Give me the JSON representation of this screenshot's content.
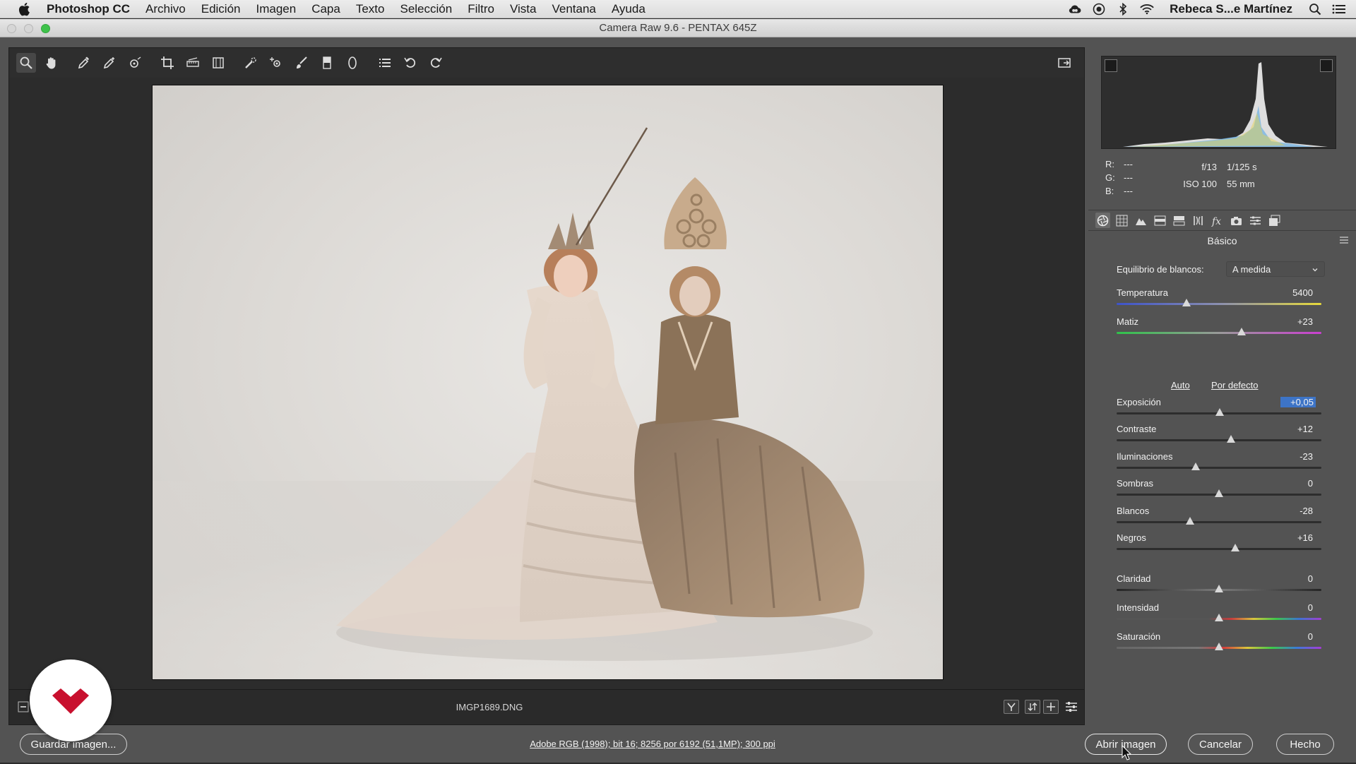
{
  "menubar": {
    "app_name": "Photoshop CC",
    "items": [
      "Archivo",
      "Edición",
      "Imagen",
      "Capa",
      "Texto",
      "Selección",
      "Filtro",
      "Vista",
      "Ventana",
      "Ayuda"
    ],
    "user": "Rebeca S...e Martínez"
  },
  "window": {
    "title": "Camera Raw 9.6 -  PENTAX 645Z"
  },
  "image": {
    "filename": "IMGP1689.DNG"
  },
  "readout": {
    "r_label": "R:",
    "g_label": "G:",
    "b_label": "B:",
    "r": "---",
    "g": "---",
    "b": "---"
  },
  "exif": {
    "aperture": "f/13",
    "shutter": "1/125 s",
    "iso": "ISO 100",
    "focal": "55 mm"
  },
  "panel": {
    "section_title": "Básico",
    "white_balance_label": "Equilibrio de blancos:",
    "white_balance_value": "A medida",
    "auto_link": "Auto",
    "default_link": "Por defecto",
    "sliders": {
      "temperature": {
        "label": "Temperatura",
        "value": "5400",
        "level": 0.34
      },
      "tint": {
        "label": "Matiz",
        "value": "+23",
        "level": 0.61
      },
      "exposure": {
        "label": "Exposición",
        "value": "+0,05",
        "level": 0.505
      },
      "contrast": {
        "label": "Contraste",
        "value": "+12",
        "level": 0.56
      },
      "highlights": {
        "label": "Iluminaciones",
        "value": "-23",
        "level": 0.385
      },
      "shadows": {
        "label": "Sombras",
        "value": "0",
        "level": 0.5
      },
      "whites": {
        "label": "Blancos",
        "value": "-28",
        "level": 0.36
      },
      "blacks": {
        "label": "Negros",
        "value": "+16",
        "level": 0.58
      },
      "clarity": {
        "label": "Claridad",
        "value": "0",
        "level": 0.5
      },
      "vibrance": {
        "label": "Intensidad",
        "value": "0",
        "level": 0.5
      },
      "saturation": {
        "label": "Saturación",
        "value": "0",
        "level": 0.5
      }
    }
  },
  "bottombar": {
    "save_label": "Guardar imagen...",
    "workflow": "Adobe RGB (1998); bit 16; 8256 por 6192 (51,1MP); 300 ppi",
    "open_label": "Abrir imagen",
    "cancel_label": "Cancelar",
    "done_label": "Hecho"
  },
  "colors": {
    "accent": "#3d74c7",
    "panel": "#535353",
    "workspace": "#2d2d2d"
  }
}
